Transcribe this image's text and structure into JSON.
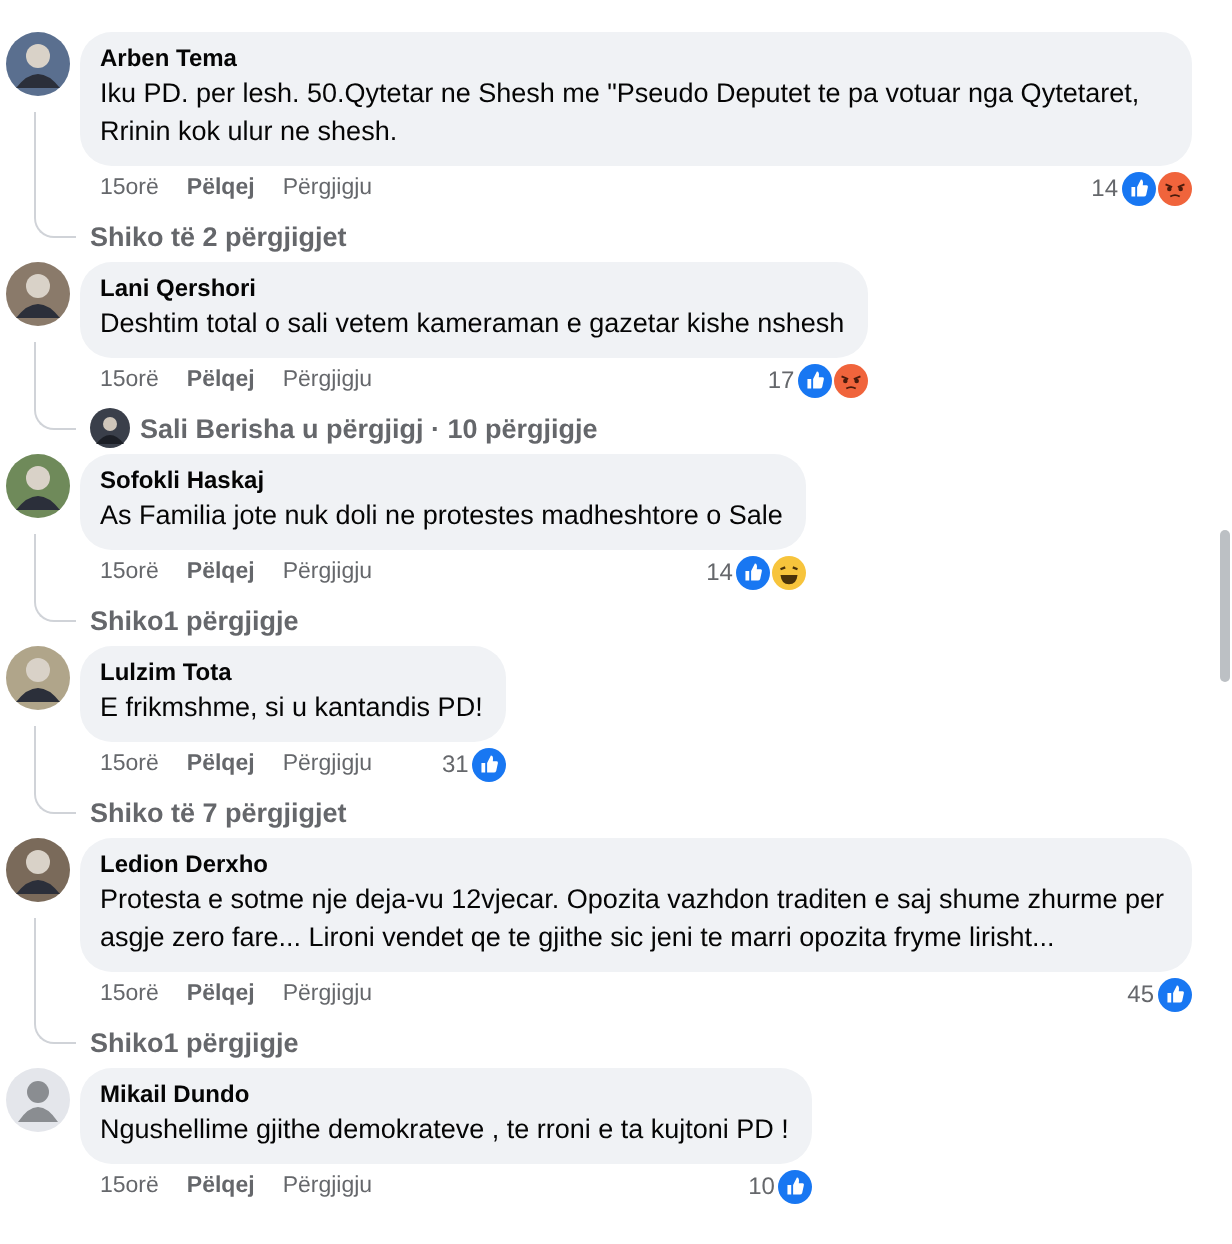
{
  "comments": [
    {
      "author": "Arben Tema",
      "avatar": {
        "kind": "photo"
      },
      "text": "Iku PD. per lesh. 50.Qytetar ne Shesh me \"Pseudo Deputet te pa votuar nga Qytetaret, Rrinin kok ulur ne shesh.",
      "time": "15orë",
      "like": "Pëlqej",
      "reply": "Përgjigju",
      "count": "14",
      "reactions": [
        {
          "kind": "like"
        },
        {
          "kind": "angry"
        }
      ],
      "replies": {
        "kind": "link",
        "text": "Shiko të 2 përgjigjet"
      }
    },
    {
      "author": "Lani Qershori",
      "avatar": {
        "kind": "photo"
      },
      "text": "Deshtim total o sali vetem kameraman e gazetar kishe nshesh",
      "time": "15orë",
      "like": "Pëlqej",
      "reply": "Përgjigju",
      "count": "17",
      "reactions": [
        {
          "kind": "like"
        },
        {
          "kind": "angry"
        }
      ],
      "replies": {
        "kind": "author",
        "text": "Sali Berisha u përgjigj · 10 përgjigje"
      }
    },
    {
      "author": "Sofokli Haskaj",
      "avatar": {
        "kind": "photo"
      },
      "text": "As Familia jote nuk doli ne protestes madheshtore o Sale",
      "time": "15orë",
      "like": "Pëlqej",
      "reply": "Përgjigju",
      "count": "14",
      "reactions": [
        {
          "kind": "like"
        },
        {
          "kind": "haha"
        }
      ],
      "replies": {
        "kind": "link",
        "text": "Shiko1 përgjigje"
      }
    },
    {
      "author": "Lulzim Tota",
      "avatar": {
        "kind": "photo"
      },
      "text": "E frikmshme, si u kantandis PD!",
      "time": "15orë",
      "like": "Pëlqej",
      "reply": "Përgjigju",
      "count": "31",
      "reactions": [
        {
          "kind": "like"
        }
      ],
      "replies": {
        "kind": "link",
        "text": "Shiko të 7 përgjigjet"
      }
    },
    {
      "author": "Ledion Derxho",
      "avatar": {
        "kind": "photo"
      },
      "text": "Protesta e sotme nje deja-vu 12vjecar. Opozita vazhdon traditen e saj shume zhurme per asgje zero fare... Lironi vendet qe te gjithe sic jeni te marri opozita fryme lirisht...",
      "time": "15orë",
      "like": "Pëlqej",
      "reply": "Përgjigju",
      "count": "45",
      "reactions": [
        {
          "kind": "like"
        }
      ],
      "replies": {
        "kind": "link",
        "text": "Shiko1 përgjigje"
      }
    },
    {
      "author": "Mikail Dundo",
      "avatar": {
        "kind": "default"
      },
      "text": "Ngushellime gjithe demokrateve , te rroni e ta kujtoni PD !",
      "time": "15orë",
      "like": "Pëlqej",
      "reply": "Përgjigju",
      "count": "10",
      "reactions": [
        {
          "kind": "like"
        }
      ]
    }
  ]
}
